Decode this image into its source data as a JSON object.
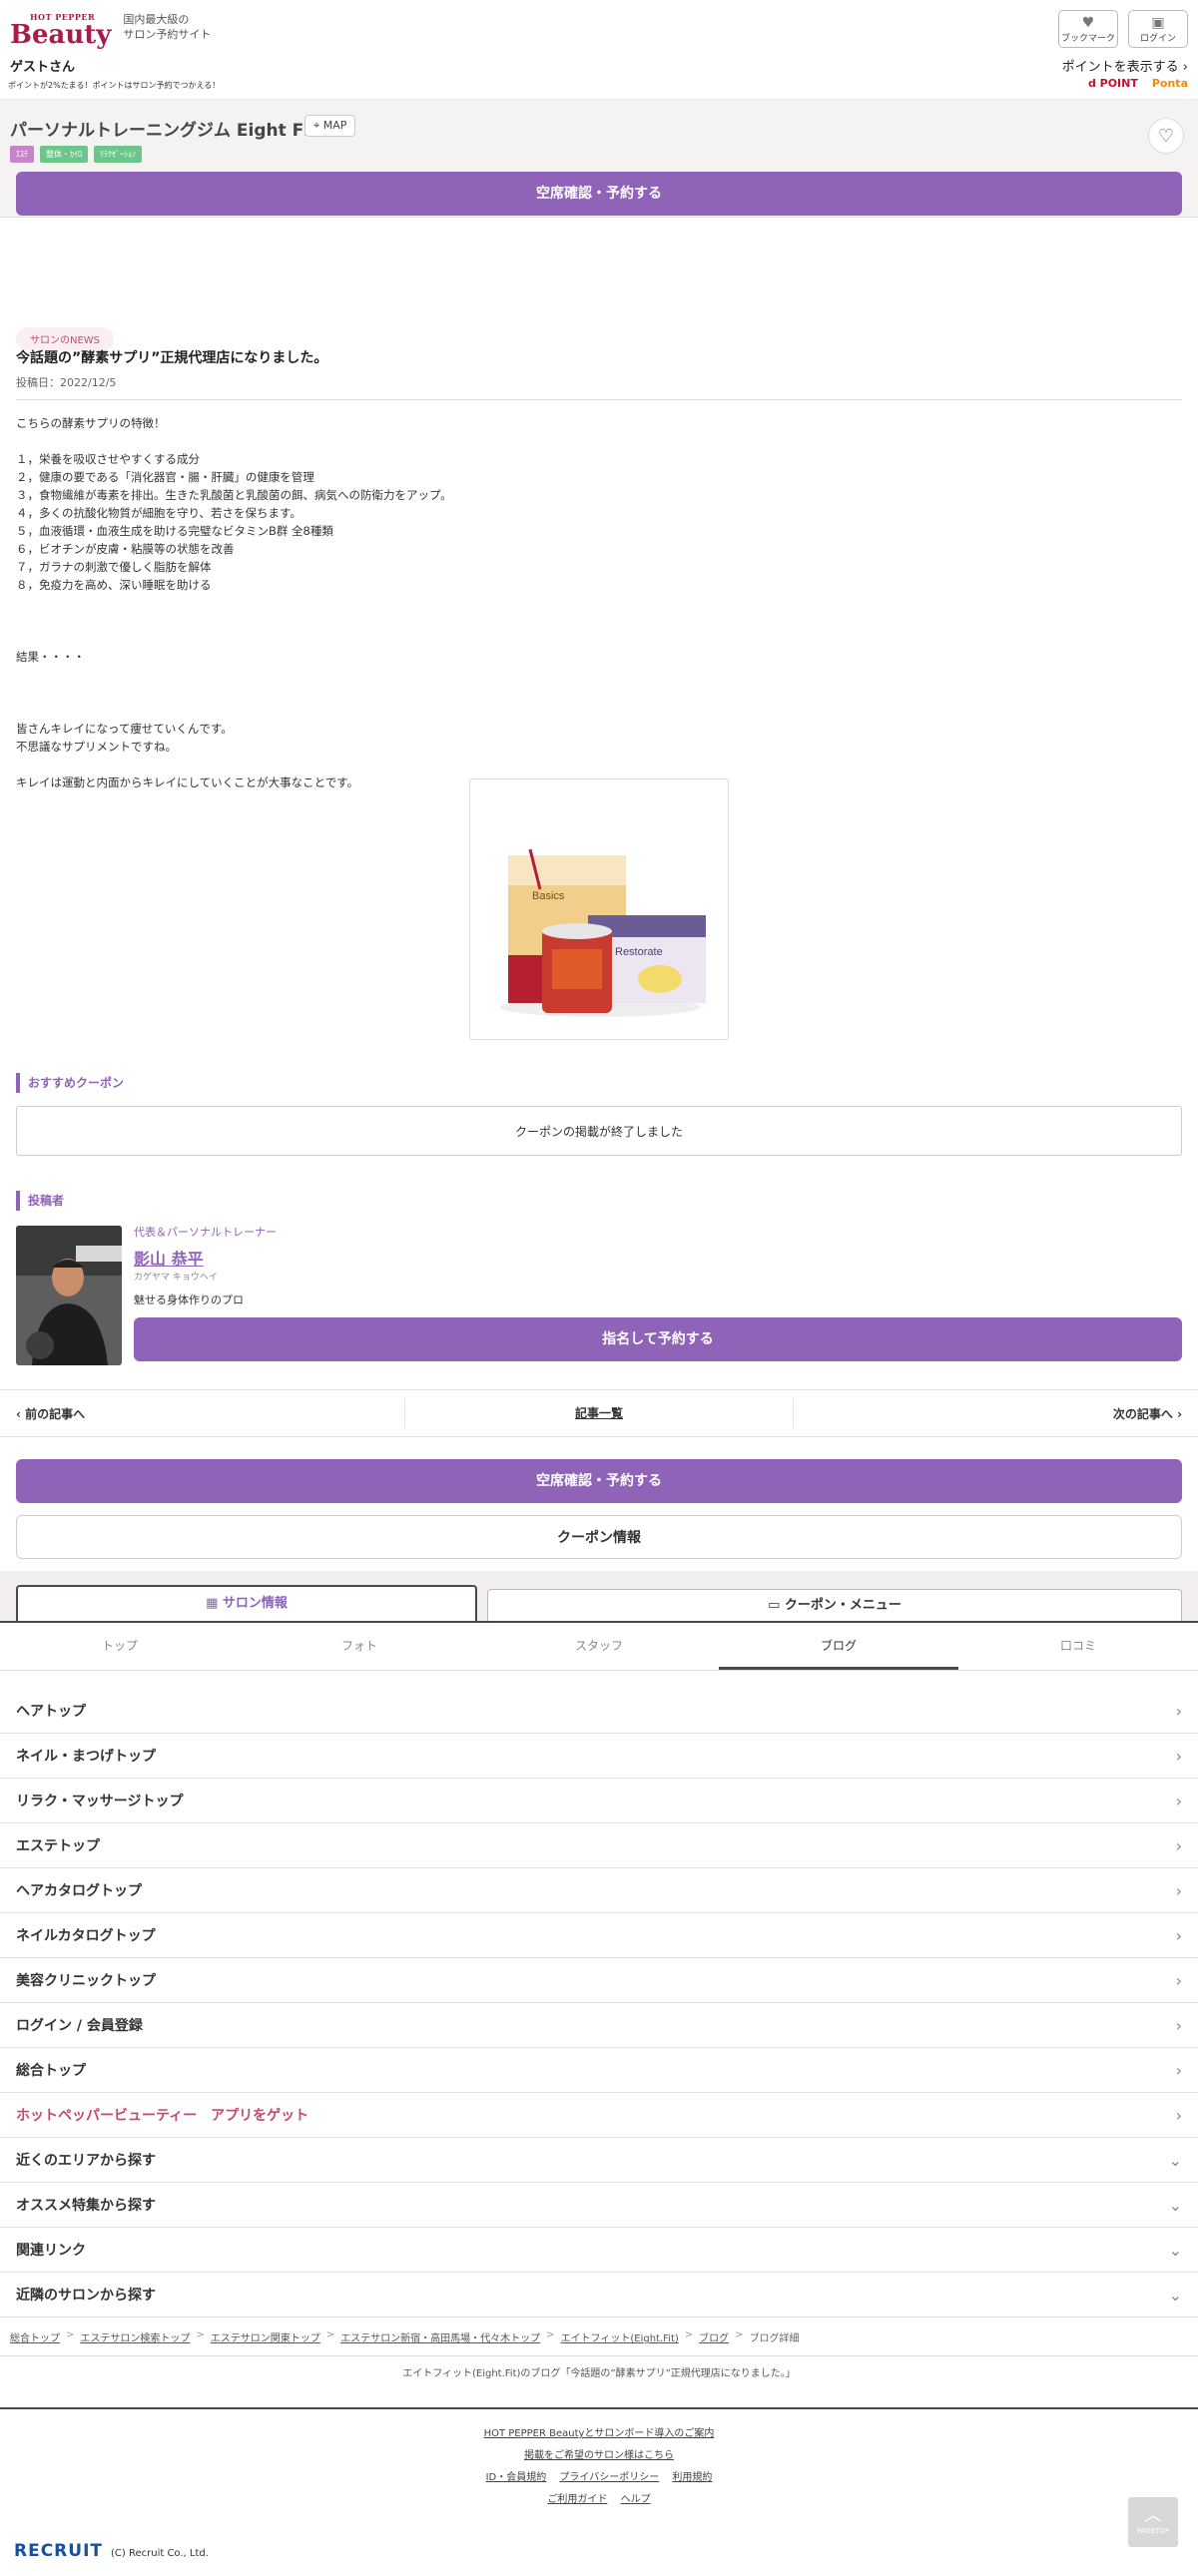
{
  "header": {
    "logo_hp": "HOT PEPPER",
    "logo_text": "Beauty",
    "tagline_1": "国内最大級の",
    "tagline_2": "サロン予約サイト",
    "bookmark_label": "ブックマーク",
    "login_label": "ログイン",
    "guest": "ゲストさん",
    "points_note": "ポイントが2%たまる！ポイントはサロン予約でつかえる！",
    "points_show": "ポイントを表示する",
    "dpoint": "d POINT",
    "ponta": "Ponta"
  },
  "salon": {
    "name": "パーソナルトレーニングジム Eight Fit.",
    "map_label": "MAP",
    "tags": [
      {
        "label": "ｴｽﾃ",
        "color": "#c785c9"
      },
      {
        "label": "整体・ｶｲﾛ",
        "color": "#6cc58b"
      },
      {
        "label": "ﾘﾗｸｾﾞｰｼｮﾝ",
        "color": "#6cc58b"
      }
    ],
    "reserve_label": "空席確認・予約する"
  },
  "article": {
    "badge": "サロンのNEWS",
    "title": "今話題の”酵素サプリ”正規代理店になりました。",
    "date": "投稿日：2022/12/5",
    "body": [
      "こちらの酵素サプリの特徴！",
      "",
      "１，栄養を吸収させやすくする成分",
      "２，健康の要である「消化器官・腸・肝臓」の健康を管理",
      "３，食物繊維が毒素を排出。生きた乳酸菌と乳酸菌の餌、病気への防衛力をアップ。",
      "４，多くの抗酸化物質が細胞を守り、若さを保ちます。",
      "５，血液循環・血液生成を助ける完璧なビタミンB群 全8種類",
      "６，ビオチンが皮膚・粘膜等の状態を改善",
      "７，ガラナの刺激で優しく脂肪を解体",
      "８，免疫力を高め、深い睡眠を助ける",
      "",
      "",
      "",
      "結果・・・・",
      "",
      "",
      "",
      "皆さんキレイになって痩せていくんです。",
      "不思議なサプリメントですね。",
      "",
      "キレイは運動と内面からキレイにしていくことが大事なことです。"
    ],
    "product_label_1": "Basics",
    "product_label_2": "Restorate"
  },
  "coupon": {
    "heading": "おすすめクーポン",
    "ended": "クーポンの掲載が終了しました"
  },
  "author": {
    "heading": "投稿者",
    "role": "代表＆パーソナルトレーナー",
    "name": "影山 恭平",
    "kana": "カゲヤマ キョウヘイ",
    "copy": "魅せる身体作りのプロ",
    "reserve_label": "指名して予約する"
  },
  "pager": {
    "prev": "前の記事へ",
    "list": "記事一覧",
    "next": "次の記事へ"
  },
  "bottom": {
    "reserve_label": "空席確認・予約する",
    "coupon_label": "クーポン情報"
  },
  "tabs": {
    "salon": "サロン情報",
    "coupon_menu": "クーポン・メニュー"
  },
  "subnav": [
    "トップ",
    "フォト",
    "スタッフ",
    "ブログ",
    "口コミ"
  ],
  "links": [
    {
      "label": "ヘアトップ",
      "chev": "›"
    },
    {
      "label": "ネイル・まつげトップ",
      "chev": "›"
    },
    {
      "label": "リラク・マッサージトップ",
      "chev": "›"
    },
    {
      "label": "エステトップ",
      "chev": "›"
    },
    {
      "label": "ヘアカタログトップ",
      "chev": "›"
    },
    {
      "label": "ネイルカタログトップ",
      "chev": "›"
    },
    {
      "label": "美容クリニックトップ",
      "chev": "›"
    },
    {
      "label": "ログイン / 会員登録",
      "chev": "›"
    },
    {
      "label": "総合トップ",
      "chev": "›"
    },
    {
      "label": "ホットペッパービューティー　アプリをゲット",
      "chev": "›"
    },
    {
      "label": "近くのエリアから探す",
      "chev": "⌄"
    },
    {
      "label": "オススメ特集から探す",
      "chev": "⌄"
    },
    {
      "label": "関連リンク",
      "chev": "⌄"
    },
    {
      "label": "近隣のサロンから探す",
      "chev": "⌄"
    }
  ],
  "breadcrumb": [
    "総合トップ",
    "エステサロン検索トップ",
    "エステサロン関東トップ",
    "エステサロン新宿・高田馬場・代々木トップ",
    "エイトフィット(Eight.Fit)",
    "ブログ",
    "ブログ詳細"
  ],
  "blog_desc": "エイトフィット(Eight.Fit)のブログ「今話題の”酵素サプリ”正規代理店になりました。」",
  "footer": {
    "line1": "HOT PEPPER Beautyとサロンボード導入のご案内",
    "line2": "掲載をご希望のサロン様はこちら",
    "line3": [
      "ID・会員規約",
      "プライバシーポリシー",
      "利用規約"
    ],
    "line4": [
      "ご利用ガイド",
      "ヘルプ"
    ],
    "recruit": "RECRUIT",
    "copyright": "(C) Recruit Co., Ltd.",
    "pagetop": "PAGETOP"
  }
}
